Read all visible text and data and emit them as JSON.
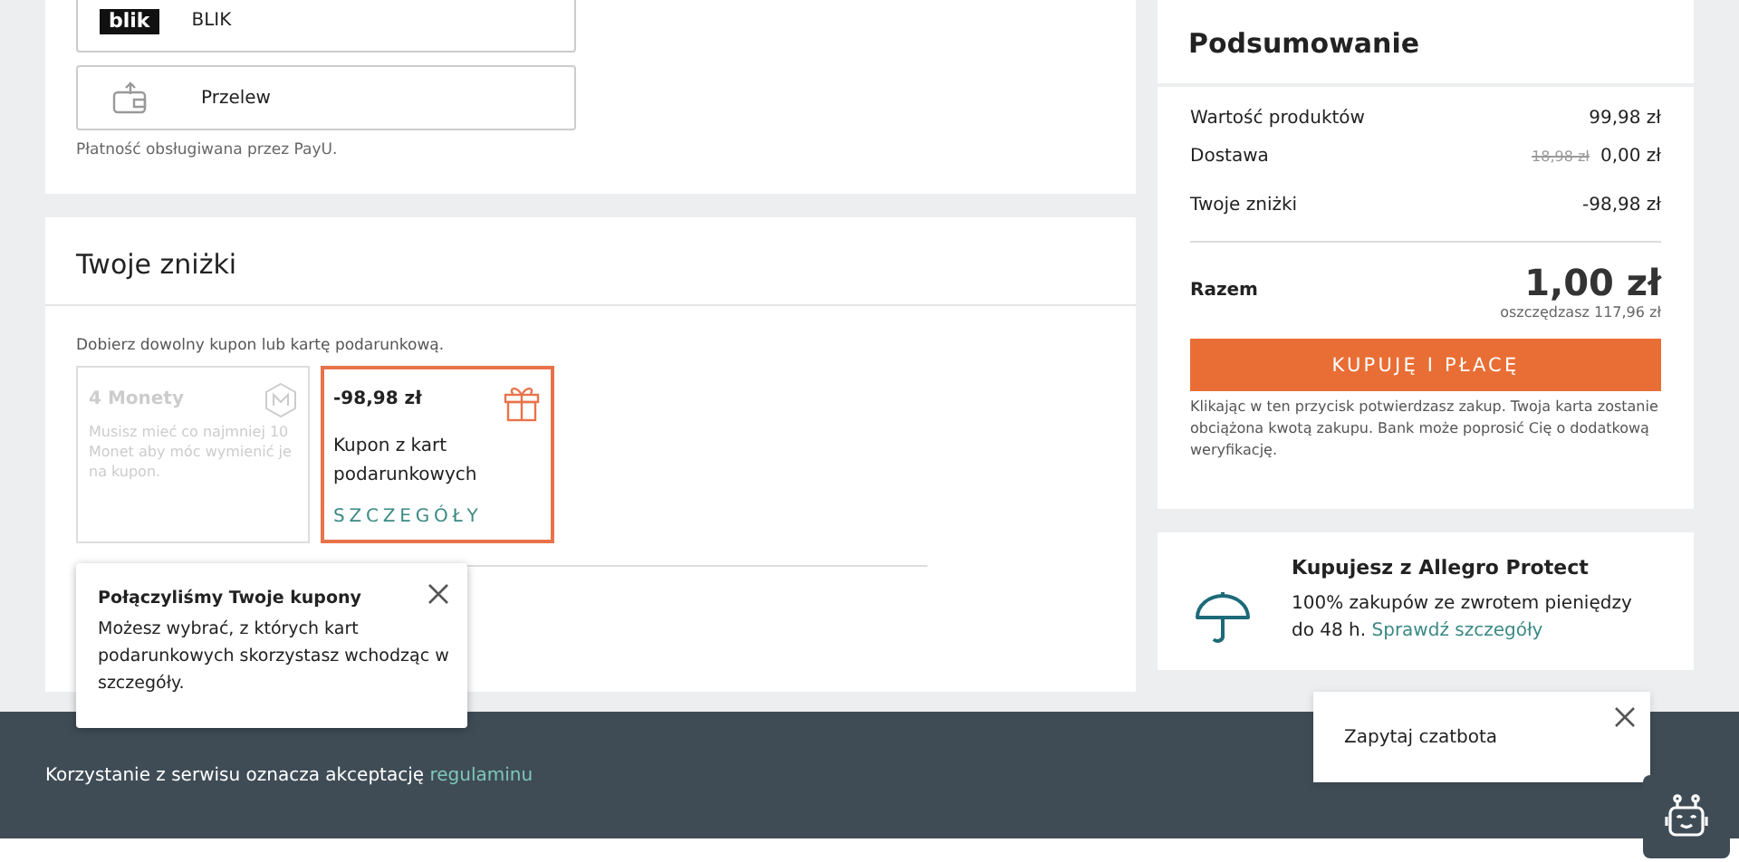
{
  "payment": {
    "methods": [
      {
        "kind": "blik",
        "logo_text": "blik",
        "label": "BLIK"
      },
      {
        "kind": "transfer",
        "label": "Przelew"
      }
    ],
    "note": "Płatność obsługiwana przez PayU."
  },
  "discounts": {
    "title": "Twoje zniżki",
    "hint": "Dobierz dowolny kupon lub kartę podarunkową.",
    "coupons": [
      {
        "kind": "coins",
        "title": "4 Monety",
        "description": "Musisz mieć co najmniej 10 Monet aby móc wymienić je na kupon.",
        "disabled": true,
        "selected": false
      },
      {
        "kind": "gift",
        "title": "-98,98 zł",
        "description": "Kupon z kart podarunkowych",
        "link": "SZCZEGÓŁY",
        "disabled": false,
        "selected": true
      }
    ]
  },
  "tooltip": {
    "title": "Połączyliśmy Twoje kupony",
    "text": "Możesz wybrać, z których kart podarunkowych skorzystasz wchodząc w szczegóły."
  },
  "summary": {
    "title": "Podsumowanie",
    "rows": [
      {
        "label": "Wartość produktów",
        "value": "99,98 zł"
      },
      {
        "label": "Dostawa",
        "old_value": "18,98 zł",
        "value": "0,00 zł"
      },
      {
        "label": "Twoje zniżki",
        "value": "-98,98 zł"
      }
    ],
    "total_label": "Razem",
    "total": "1,00 zł",
    "savings": "oszczędzasz 117,96 zł",
    "button": "KUPUJĘ I PŁACĘ",
    "note": "Klikając w ten przycisk potwierdzasz zakup. Twoja karta zostanie obciążona kwotą zakupu. Bank może poprosić Cię o dodatkową weryfikację."
  },
  "protect": {
    "title": "Kupujesz z Allegro Protect",
    "text": "100% zakupów ze zwrotem pieniędzy do 48 h.",
    "link": "Sprawdź szczegóły"
  },
  "footer": {
    "text": "Korzystanie z serwisu oznacza akceptację",
    "link": "regulaminu"
  },
  "chat_popup": {
    "text": "Zapytaj czatbota"
  }
}
